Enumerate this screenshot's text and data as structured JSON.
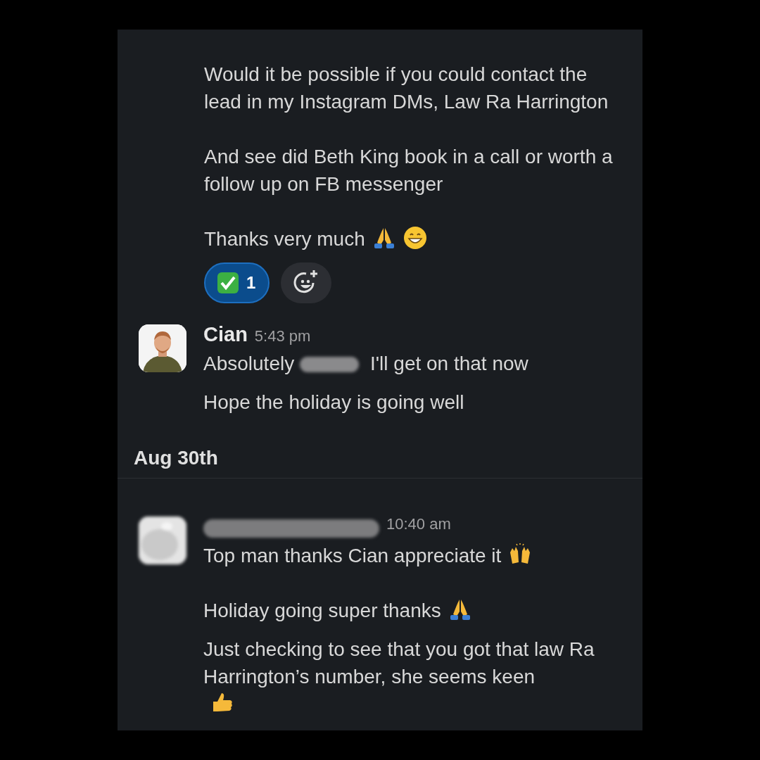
{
  "messages": [
    {
      "kind": "continuation",
      "blocks": [
        {
          "lines": [
            {
              "parts": [
                {
                  "kind": "text",
                  "text": "Would it be possible if you could contact the lead in my Instagram DMs, Law Ra Harrington"
                }
              ]
            }
          ]
        },
        {
          "lines": [
            {
              "parts": [
                {
                  "kind": "text",
                  "text": "And see did Beth King book in a call or worth a follow up on FB messenger"
                }
              ]
            }
          ]
        },
        {
          "lines": [
            {
              "parts": [
                {
                  "kind": "text",
                  "text": "Thanks very much"
                },
                {
                  "kind": "pray"
                },
                {
                  "kind": "grin"
                }
              ]
            }
          ]
        }
      ],
      "reactions": [
        {
          "kind": "check",
          "count": "1",
          "selected": true
        }
      ],
      "add_reaction": true
    },
    {
      "kind": "message",
      "author": "Cian",
      "author_redacted": false,
      "avatar": {
        "kind": "picture",
        "blurred": false
      },
      "time": "5:43 pm",
      "blocks": [
        {
          "lines": [
            {
              "parts": [
                {
                  "kind": "text",
                  "text": "Absolutely"
                },
                {
                  "kind": "redaction"
                },
                {
                  "kind": "text",
                  "text": "I'll get on that now"
                }
              ]
            },
            {
              "parts": [
                {
                  "kind": "text",
                  "text": "Hope the holiday is going well"
                }
              ]
            }
          ]
        }
      ]
    },
    {
      "kind": "date",
      "label": "Aug 30th"
    },
    {
      "kind": "message",
      "author_redacted": true,
      "avatar": {
        "kind": "picture",
        "blurred": true
      },
      "time": "10:40 am",
      "blocks": [
        {
          "lines": [
            {
              "parts": [
                {
                  "kind": "text",
                  "text": "Top man thanks Cian appreciate it"
                },
                {
                  "kind": "raised-hands"
                }
              ]
            }
          ]
        },
        {
          "lines": [
            {
              "parts": [
                {
                  "kind": "text",
                  "text": "Holiday going super thanks"
                },
                {
                  "kind": "pray"
                }
              ]
            },
            {
              "parts": [
                {
                  "kind": "text",
                  "text": "Just checking to see that you got that law Ra Harrington’s number, she seems keen"
                },
                {
                  "kind": "thumbs-up"
                }
              ]
            }
          ]
        }
      ]
    }
  ]
}
